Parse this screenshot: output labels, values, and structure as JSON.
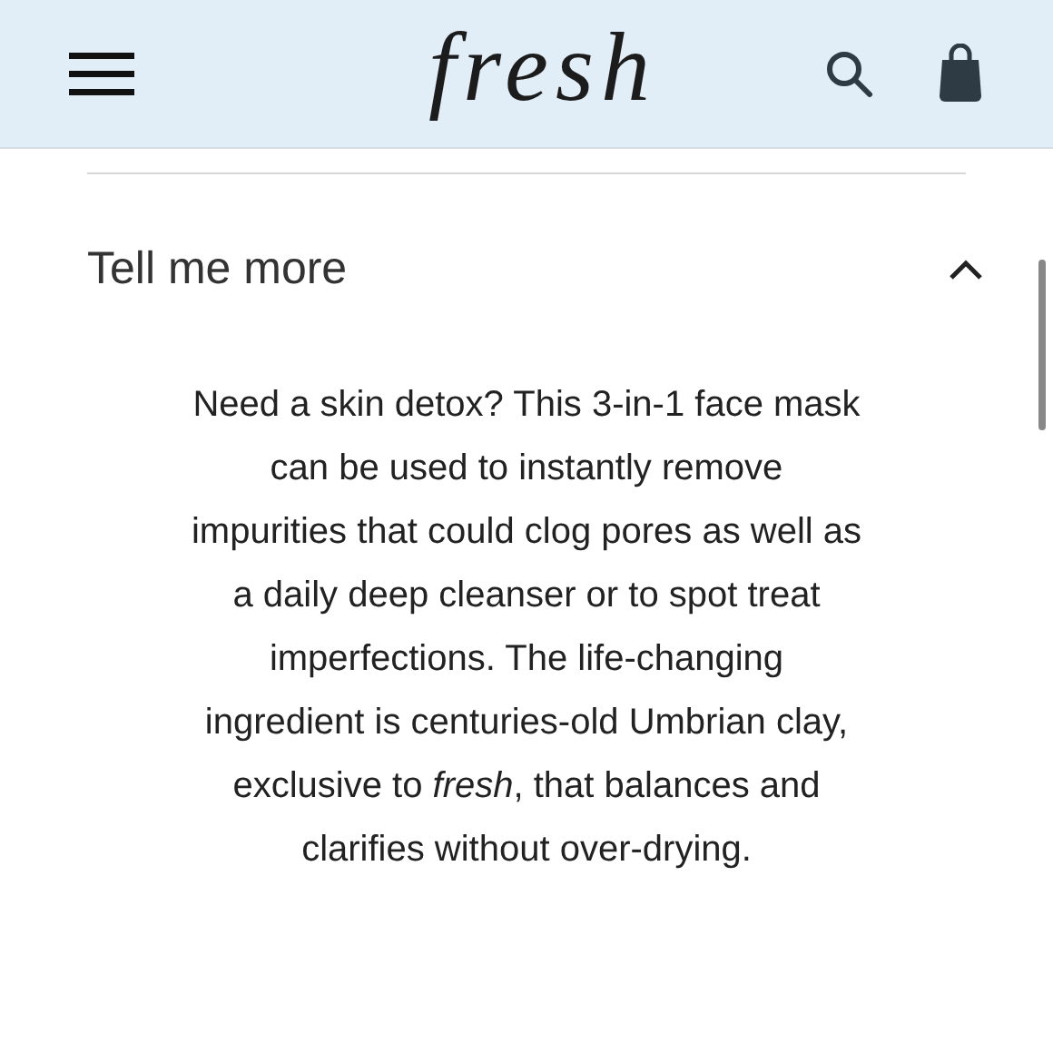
{
  "header": {
    "logo": "fresh"
  },
  "accordion": {
    "title": "Tell me more",
    "expanded": true,
    "body": "Need a skin detox? This 3-in-1 face mask can be used to instantly remove impurities that could clog pores as well as a daily deep cleanser or to spot treat imperfections. The life-changing ingredient is centuries-old Umbrian clay, exclusive to *fresh*, that balances and clarifies without over-drying."
  }
}
